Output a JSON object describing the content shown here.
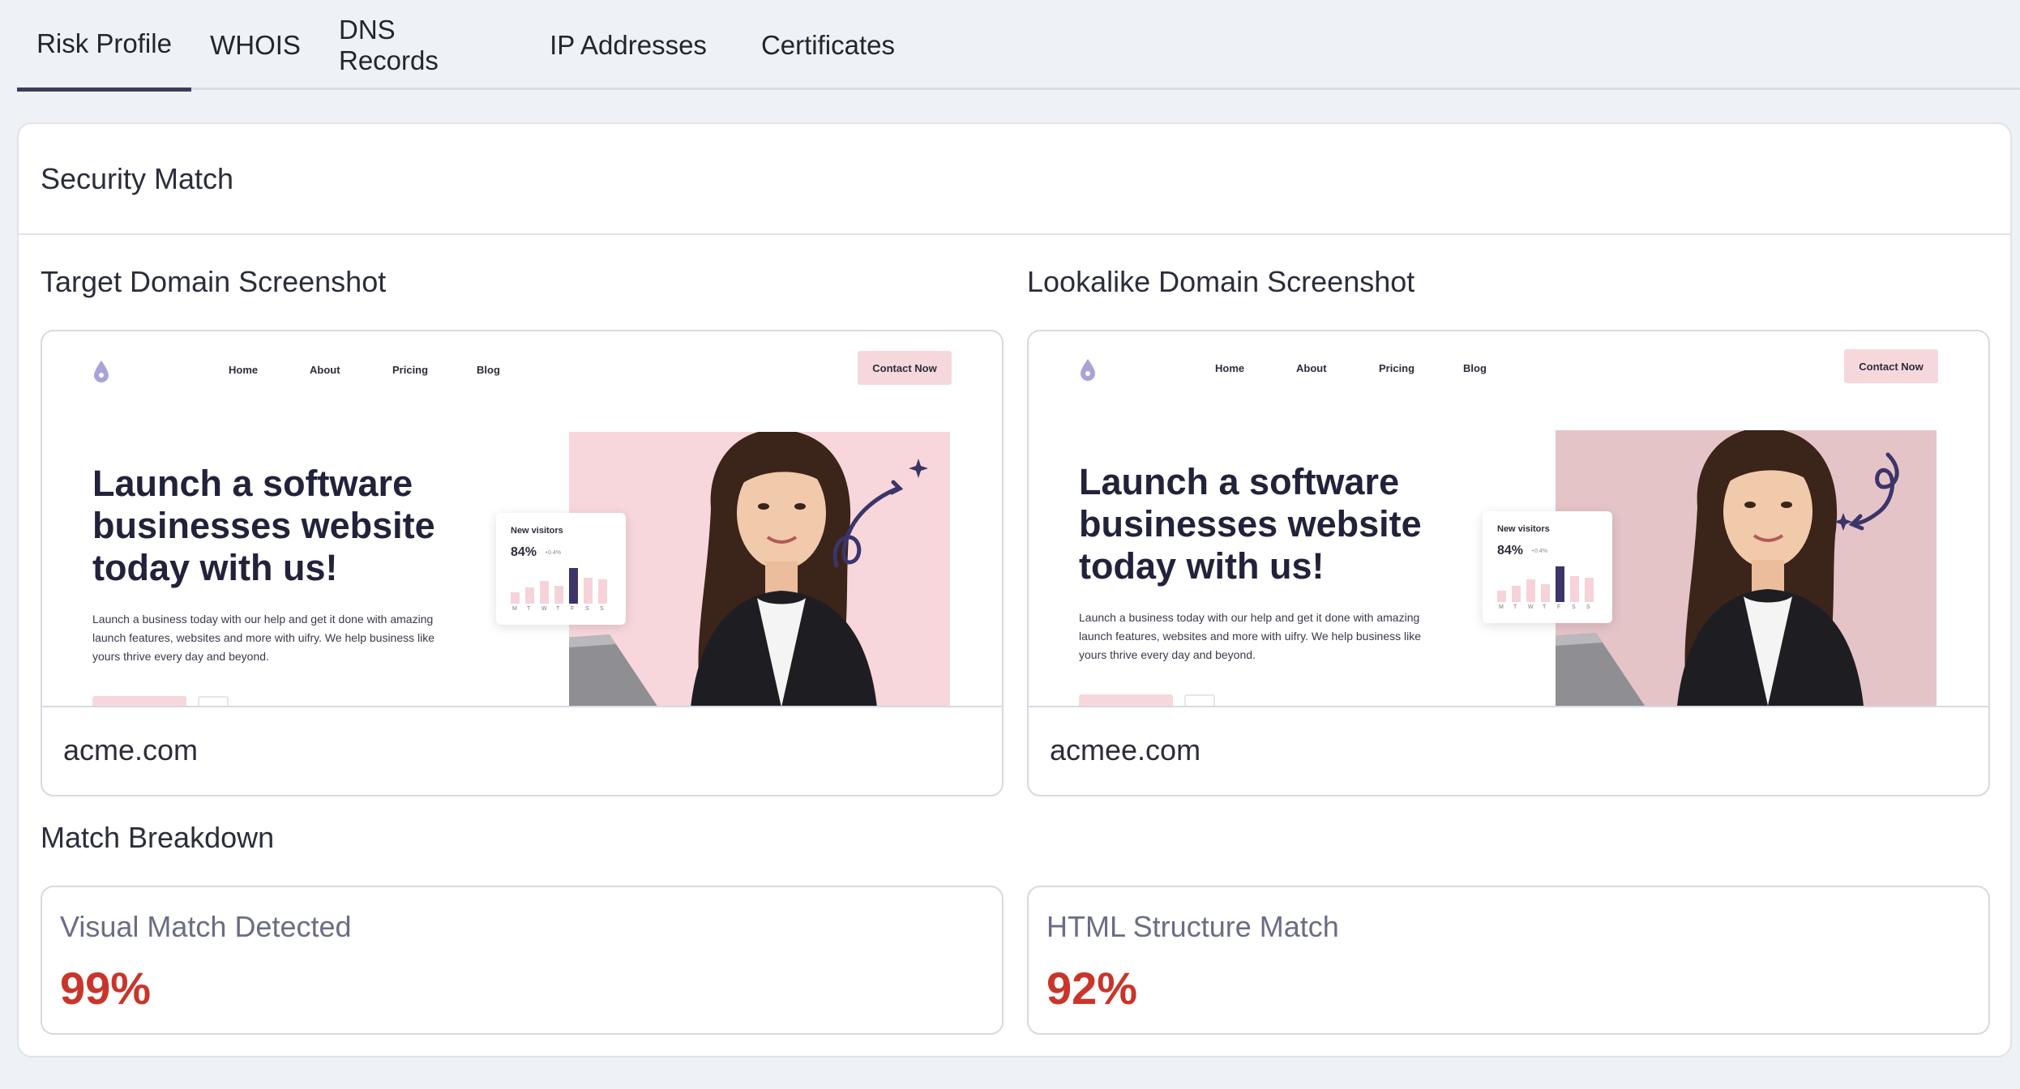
{
  "tabs": [
    {
      "label": "Risk Profile",
      "active": true
    },
    {
      "label": "WHOIS",
      "active": false
    },
    {
      "label": "DNS Records",
      "active": false
    },
    {
      "label": "IP Addresses",
      "active": false
    },
    {
      "label": "Certificates",
      "active": false
    }
  ],
  "security": {
    "title": "Security Match",
    "target": {
      "heading": "Target Domain Screenshot",
      "domain": "acme.com",
      "site": {
        "nav": [
          "Home",
          "About",
          "Pricing",
          "Blog"
        ],
        "cta": "Contact Now",
        "headline": "Launch a software businesses website today with us!",
        "body": "Launch a business today with our help and get it done with amazing launch features, websites and more with uifry. We help business like yours thrive every day and beyond.",
        "widget_title": "New visitors",
        "widget_value": "84%",
        "widget_delta": "+0.4%",
        "days": [
          "M",
          "T",
          "W",
          "T",
          "F",
          "S",
          "S"
        ],
        "panel_color": "#f7d7dc"
      }
    },
    "lookalike": {
      "heading": "Lookalike Domain Screenshot",
      "domain": "acmee.com",
      "site": {
        "nav": [
          "Home",
          "About",
          "Pricing",
          "Blog"
        ],
        "cta": "Contact Now",
        "headline": "Launch a software businesses website today with us!",
        "body": "Launch a business today with our help and get it done with amazing launch features, websites and more with uifry. We help business like yours thrive every day and beyond.",
        "widget_title": "New visitors",
        "widget_value": "84%",
        "widget_delta": "+0.4%",
        "days": [
          "M",
          "T",
          "W",
          "T",
          "F",
          "S",
          "S"
        ],
        "panel_color": "#e5c4c8"
      }
    },
    "breakdown": {
      "title": "Match Breakdown",
      "visual": {
        "label": "Visual Match Detected",
        "value": "99%"
      },
      "html": {
        "label": "HTML Structure Match",
        "value": "92%"
      }
    }
  },
  "colors": {
    "accent_red": "#c9352a",
    "tab_underline": "#3a3f58",
    "page_bg": "#eef1f5"
  }
}
